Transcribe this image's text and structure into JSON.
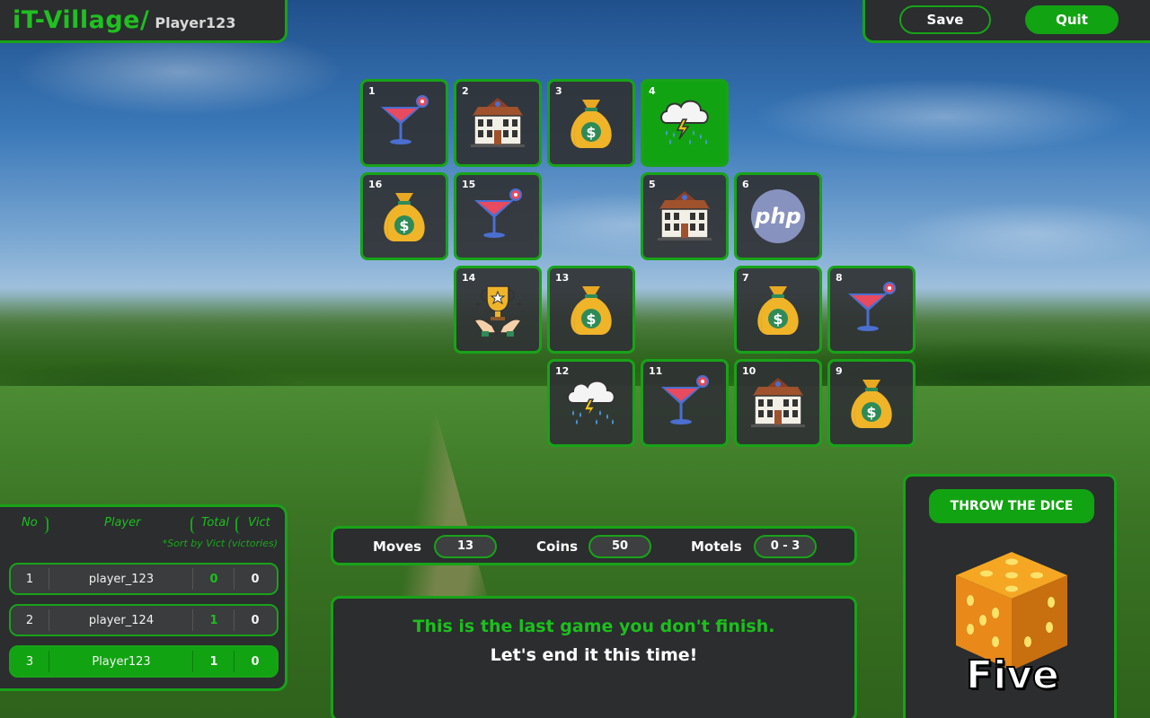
{
  "header": {
    "app_title": "iT-Village/",
    "player_name": "Player123",
    "save_label": "Save",
    "quit_label": "Quit"
  },
  "board": {
    "tiles": [
      {
        "num": "1",
        "icon": "cocktail-icon"
      },
      {
        "num": "2",
        "icon": "motel-icon"
      },
      {
        "num": "3",
        "icon": "money-bag-icon"
      },
      {
        "num": "4",
        "icon": "storm-cloud-icon",
        "active": true
      },
      {
        "num": "5",
        "icon": "motel-icon"
      },
      {
        "num": "6",
        "icon": "php-icon",
        "text": "php"
      },
      {
        "num": "7",
        "icon": "money-bag-icon"
      },
      {
        "num": "8",
        "icon": "cocktail-icon"
      },
      {
        "num": "9",
        "icon": "money-bag-icon"
      },
      {
        "num": "10",
        "icon": "motel-icon"
      },
      {
        "num": "11",
        "icon": "cocktail-icon"
      },
      {
        "num": "12",
        "icon": "storm-cloud-icon"
      },
      {
        "num": "13",
        "icon": "money-bag-icon"
      },
      {
        "num": "14",
        "icon": "trophy-icon"
      },
      {
        "num": "15",
        "icon": "cocktail-icon"
      },
      {
        "num": "16",
        "icon": "money-bag-icon"
      }
    ]
  },
  "leaderboard": {
    "headers": {
      "no": "No",
      "player": "Player",
      "total": "Total",
      "vict": "Vict"
    },
    "sort_note": "*Sort by Vict (victories)",
    "rows": [
      {
        "no": "1",
        "player": "player_123",
        "total": "0",
        "vict": "0"
      },
      {
        "no": "2",
        "player": "player_124",
        "total": "1",
        "vict": "0"
      },
      {
        "no": "3",
        "player": "Player123",
        "total": "1",
        "vict": "0"
      }
    ]
  },
  "stats": {
    "moves_label": "Moves",
    "moves_value": "13",
    "coins_label": "Coins",
    "coins_value": "50",
    "motels_label": "Motels",
    "motels_value": "0 - 3"
  },
  "message": {
    "line1": "This is the last game you don't finish.",
    "line2": "Let's end it this time!"
  },
  "dice": {
    "button_label": "THROW THE DICE",
    "result": "Five"
  },
  "colors": {
    "accent": "#18a318",
    "panel": "#2b2d2f",
    "accent_text": "#1cc01c"
  }
}
